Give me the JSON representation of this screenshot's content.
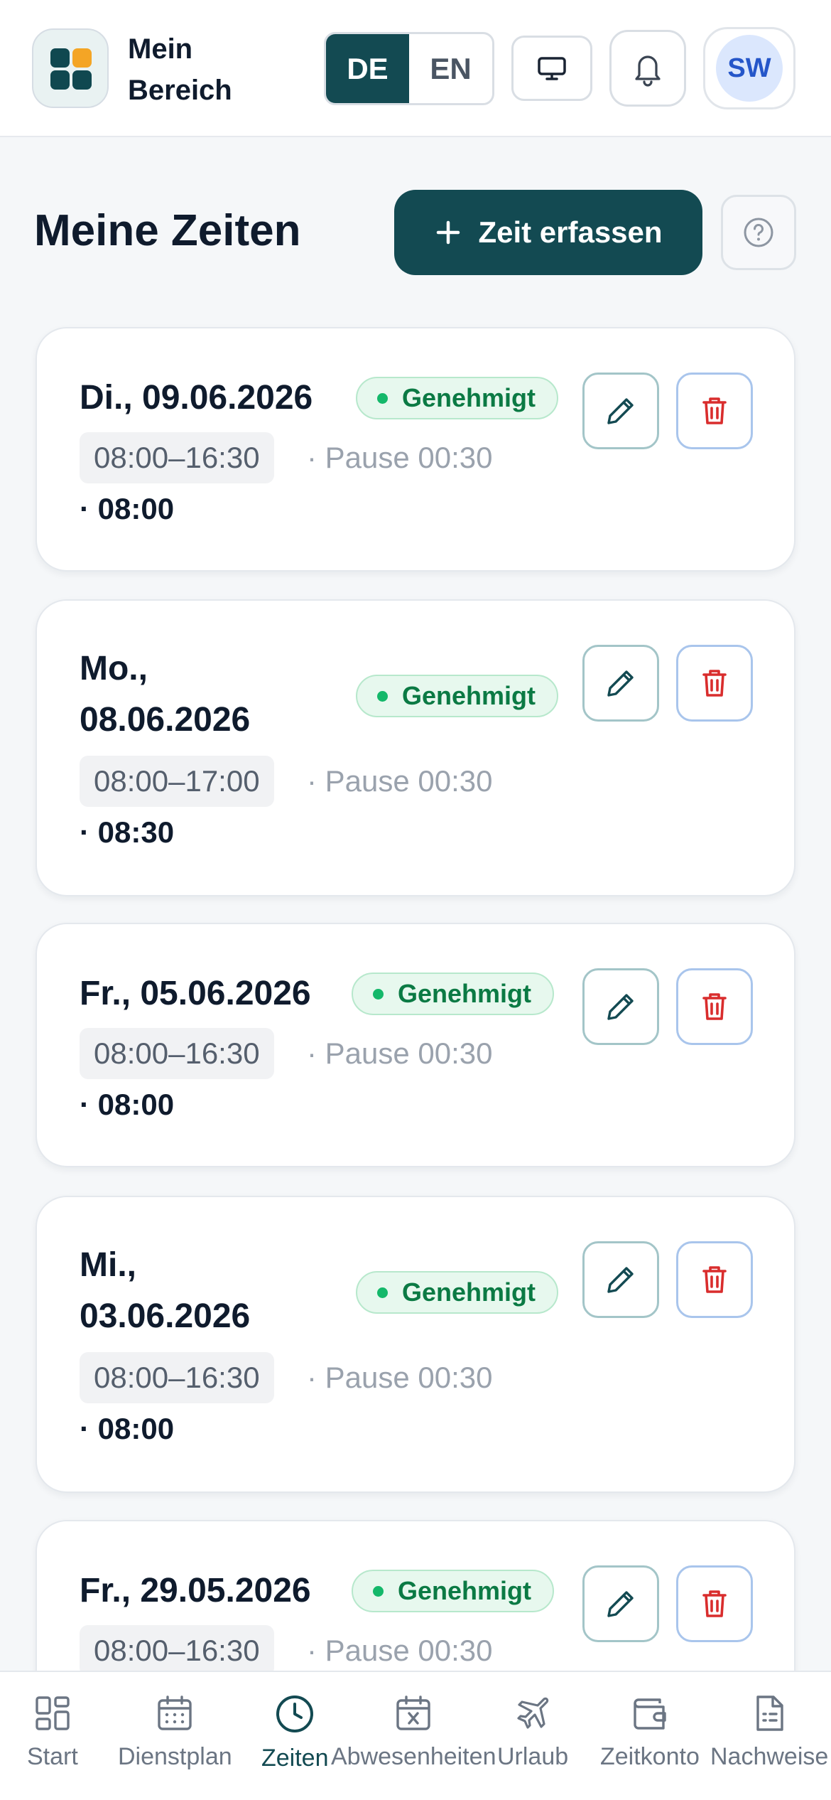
{
  "header": {
    "brand_line1": "Mein",
    "brand_line2": "Bereich",
    "lang_de": "DE",
    "lang_en": "EN",
    "lang_active": "DE",
    "avatar_initials": "SW"
  },
  "page": {
    "title": "Meine Zeiten",
    "add_button_label": "Zeit erfassen",
    "add_button_icon": "plus-icon",
    "help_icon": "question-circle-icon"
  },
  "entries": [
    {
      "date": "Di., 09.06.2026",
      "status": "Genehmigt",
      "time": "08:00–16:30",
      "pause": "· Pause 00:30",
      "total": "· 08:00"
    },
    {
      "date": "Mo., 08.06.2026",
      "status": "Genehmigt",
      "time": "08:00–17:00",
      "pause": "· Pause 00:30",
      "total": "· 08:30"
    },
    {
      "date": "Fr., 05.06.2026",
      "status": "Genehmigt",
      "time": "08:00–16:30",
      "pause": "· Pause 00:30",
      "total": "· 08:00"
    },
    {
      "date": "Mi., 03.06.2026",
      "status": "Genehmigt",
      "time": "08:00–16:30",
      "pause": "· Pause 00:30",
      "total": "· 08:00"
    },
    {
      "date": "Fr., 29.05.2026",
      "status": "Genehmigt",
      "time": "08:00–16:30",
      "pause": "· Pause 00:30",
      "total": ""
    }
  ],
  "colors": {
    "primary": "#134a52",
    "success_text": "#0b7a44",
    "success_dot": "#14b86a",
    "delete_red": "#d92d2d",
    "avatar_text": "#2556c9"
  },
  "nav": {
    "active": "Zeiten",
    "items": [
      {
        "label": "Start",
        "icon": "grid-icon"
      },
      {
        "label": "Dienstplan",
        "icon": "calendar-icon"
      },
      {
        "label": "Zeiten",
        "icon": "clock-icon"
      },
      {
        "label": "Abwesenheiten",
        "icon": "calendar-x-icon"
      },
      {
        "label": "Urlaub",
        "icon": "plane-icon"
      },
      {
        "label": "Zeitkonto",
        "icon": "wallet-icon"
      },
      {
        "label": "Nachweise",
        "icon": "document-icon"
      }
    ]
  }
}
